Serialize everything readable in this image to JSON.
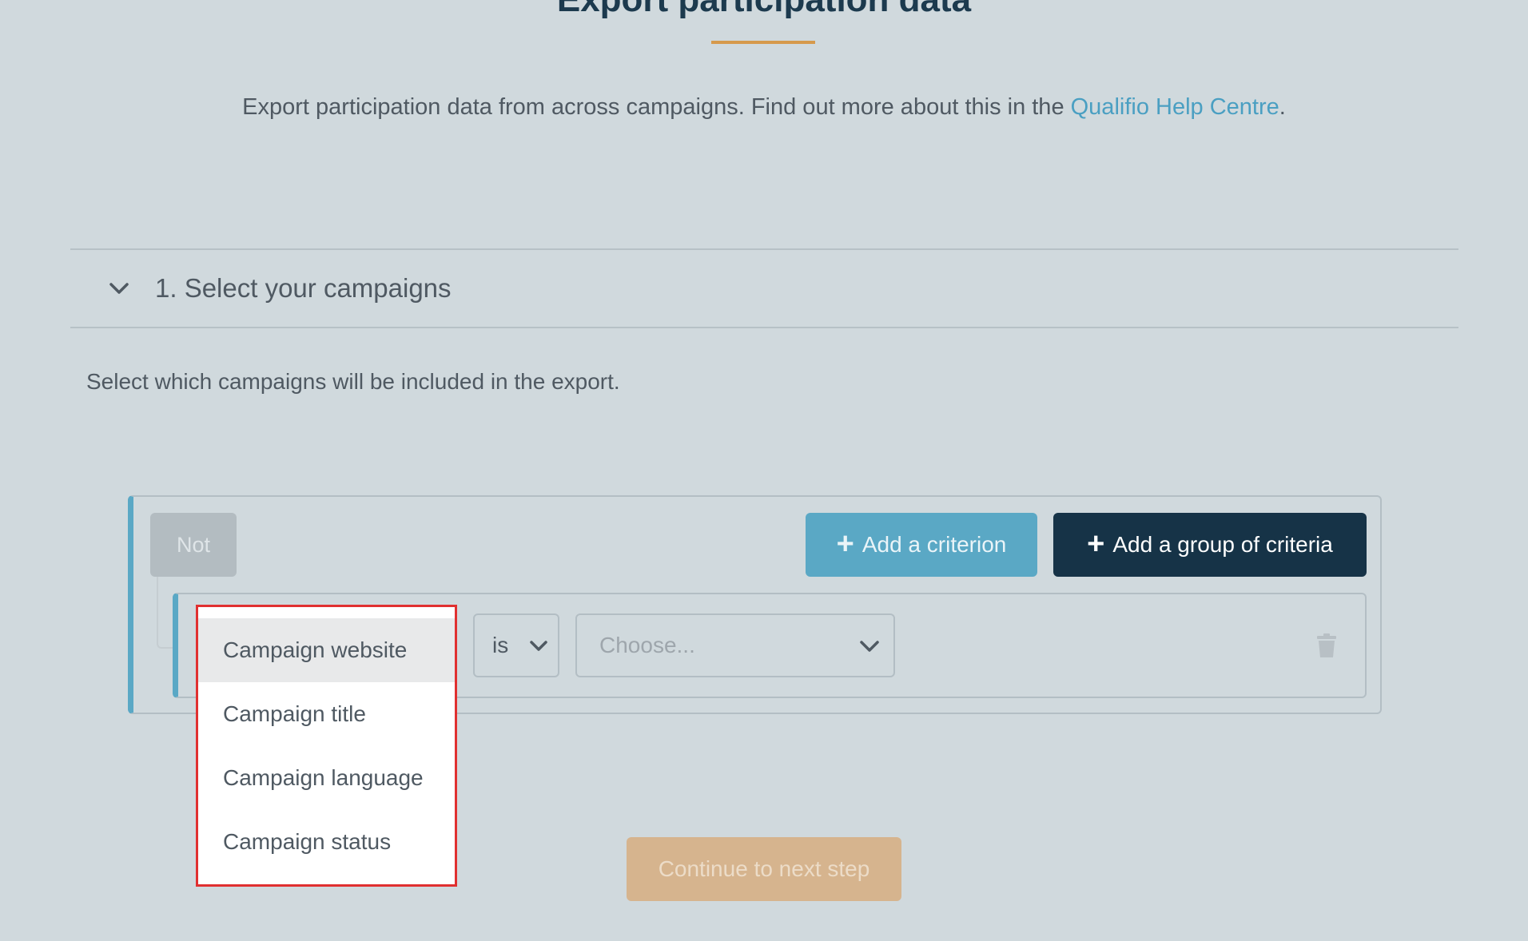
{
  "page": {
    "title": "Export participation data",
    "intro_text": "Export participation data from across campaigns. Find out more about this in the ",
    "intro_link": "Qualifio Help Centre",
    "intro_suffix": "."
  },
  "section": {
    "header_label": "1. Select your campaigns",
    "description": "Select which campaigns will be included in the export."
  },
  "builder": {
    "not_label": "Not",
    "add_criterion_label": "Add a criterion",
    "add_group_label": "Add a group of criteria",
    "operator_value": "is",
    "value_placeholder": "Choose...",
    "field_options": [
      "Campaign website",
      "Campaign title",
      "Campaign language",
      "Campaign status"
    ],
    "highlighted_option": "Campaign website"
  },
  "footer": {
    "continue_label": "Continue to next step"
  },
  "colors": {
    "background": "#d0d9dd",
    "title": "#1c3a4e",
    "accent_orange": "#d69a4c",
    "link": "#4a9fc2",
    "criterion_button": "#5aa8c5",
    "group_button": "#163347",
    "continue_button": "#d6b48e",
    "dropdown_highlight_border": "#e03030"
  },
  "icons": {
    "section_toggle": "chevron-down-icon",
    "add": "plus-icon",
    "select_arrow": "chevron-down-icon",
    "delete": "trash-icon"
  }
}
